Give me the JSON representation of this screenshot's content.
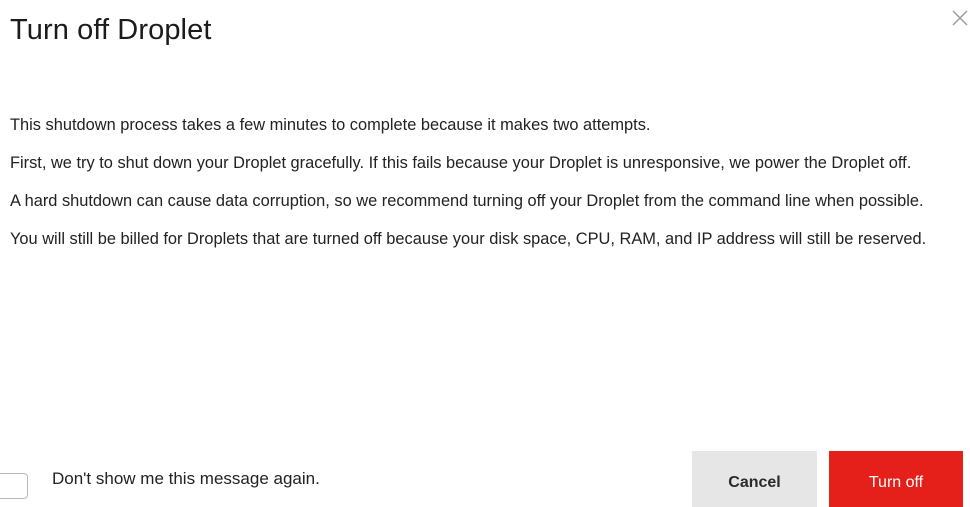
{
  "dialog": {
    "title": "Turn off Droplet",
    "close_icon": "close-icon",
    "paragraphs": [
      "This shutdown process takes a few minutes to complete because it makes two attempts.",
      "First, we try to shut down your Droplet gracefully. If this fails because your Droplet is unresponsive, we power the Droplet off.",
      "A hard shutdown can cause data corruption, so we recommend turning off your Droplet from the command line when possible.",
      "You will still be billed for Droplets that are turned off because your disk space, CPU, RAM, and IP address will still be reserved."
    ],
    "checkbox": {
      "label": "Don't show me this message again.",
      "checked": false
    },
    "buttons": {
      "cancel_label": "Cancel",
      "turn_off_label": "Turn off"
    },
    "colors": {
      "primary_button": "#e5201b",
      "secondary_button": "#e6e6e6"
    }
  }
}
